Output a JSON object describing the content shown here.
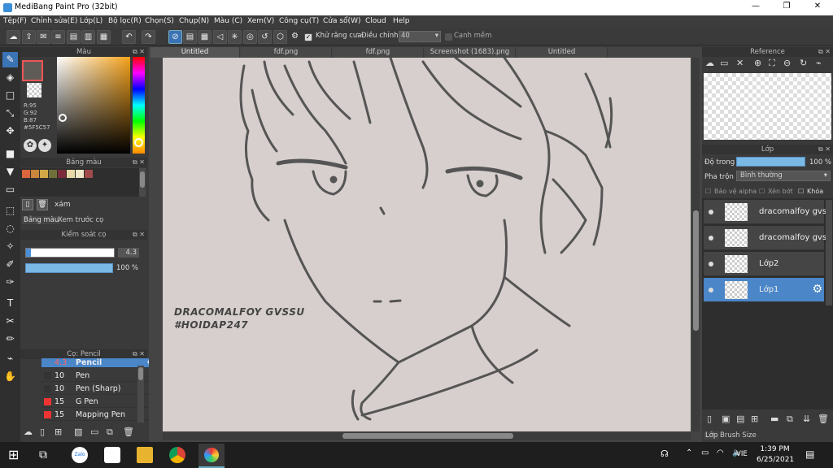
{
  "window": {
    "title": "MediBang Paint Pro (32bit)",
    "min": "—",
    "max": "❐",
    "close": "✕"
  },
  "menu": [
    "Tệp(F)",
    "Chỉnh sửa(E)",
    "Lớp(L)",
    "Bộ lọc(R)",
    "Chọn(S)",
    "Chụp(N)",
    "Màu (C)",
    "Xem(V)",
    "Công cụ(T)",
    "Cửa sổ(W)",
    "Cloud",
    "Help"
  ],
  "toolbar": {
    "antialias_label": "Khử răng cưa",
    "adjust_label": "Điều chỉnh",
    "adjust_value": "40",
    "edge_label": "Cạnh mềm"
  },
  "tabs": [
    "Untitled",
    "fdf.png",
    "fdf.png",
    "Screenshot (1683).png",
    "Untitled"
  ],
  "color_panel": {
    "title": "Màu",
    "r": "R:95",
    "g": "G:92",
    "b": "B:87",
    "hex": "#5F5C57",
    "current": "#5F5C57"
  },
  "palette_panel": {
    "title": "Bảng màu",
    "swatches": [
      "#d9663e",
      "#c9863c",
      "#d1a848",
      "#6f6f3a",
      "#7a2a3a",
      "#e8d8a8",
      "#f0e8c8",
      "#a04a4a"
    ],
    "item": "xám",
    "tab1": "Bảng màu",
    "tab2": "Xem trước cọ"
  },
  "brush_control": {
    "title": "Kiểm soát cọ",
    "size": "4.3",
    "opacity": "100 %"
  },
  "brush_panel": {
    "title": "Cọ: Pencil",
    "items": [
      {
        "size": "4.3",
        "name": "Pencil",
        "color": "#3b74b5"
      },
      {
        "size": "10",
        "name": "Pen",
        "color": "#333"
      },
      {
        "size": "10",
        "name": "Pen (Sharp)",
        "color": "#333"
      },
      {
        "size": "15",
        "name": "G Pen",
        "color": "#e33"
      },
      {
        "size": "15",
        "name": "Mapping Pen",
        "color": "#e33"
      }
    ]
  },
  "reference_panel": {
    "title": "Reference"
  },
  "layer_panel": {
    "title": "Lớp",
    "opacity_label": "Độ trong",
    "opacity_value": "100 %",
    "blend_label": "Pha trộn",
    "blend_value": "Bình thường",
    "protect_alpha": "Bảo vệ alpha",
    "clip": "Xén bớt",
    "lock": "Khóa",
    "layers": [
      "dracomalfoy gvs",
      "dracomalfoy gvs",
      "Lớp2",
      "Lớp1"
    ],
    "tab1": "Lớp",
    "tab2": "Brush Size"
  },
  "canvas": {
    "watermark1": "DRACOMALFOY GVSSU",
    "watermark2": "#HOIDAP247"
  },
  "taskbar": {
    "time": "1:39 PM",
    "date": "6/25/2021",
    "lang": "VIE"
  }
}
